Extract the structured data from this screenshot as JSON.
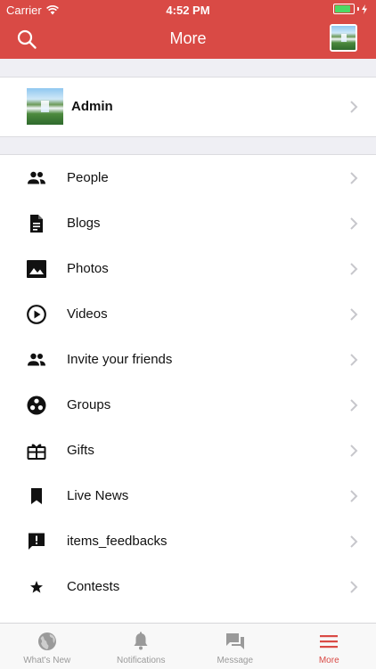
{
  "status_bar": {
    "carrier": "Carrier",
    "time": "4:52 PM",
    "battery_level": 0.95
  },
  "nav": {
    "title": "More",
    "search_icon": "search-icon",
    "avatar_icon": "user-avatar"
  },
  "admin": {
    "name": "Admin"
  },
  "menu": {
    "items": [
      {
        "label": "People",
        "icon": "people-icon"
      },
      {
        "label": "Blogs",
        "icon": "document-icon"
      },
      {
        "label": "Photos",
        "icon": "photo-icon"
      },
      {
        "label": "Videos",
        "icon": "play-circle-icon"
      },
      {
        "label": "Invite your friends",
        "icon": "people-icon"
      },
      {
        "label": "Groups",
        "icon": "groups-icon"
      },
      {
        "label": "Gifts",
        "icon": "gift-icon"
      },
      {
        "label": "Live News",
        "icon": "bookmark-icon"
      },
      {
        "label": "items_feedbacks",
        "icon": "feedback-icon"
      },
      {
        "label": "Contests",
        "icon": "star-icon"
      }
    ]
  },
  "tabbar": {
    "tabs": [
      {
        "label": "What's New",
        "icon": "globe-icon"
      },
      {
        "label": "Notifications",
        "icon": "bell-icon"
      },
      {
        "label": "Message",
        "icon": "chat-icon"
      },
      {
        "label": "More",
        "icon": "menu-icon",
        "active": true
      }
    ]
  },
  "colors": {
    "accent": "#d94a45",
    "inactive": "#9a9a9a"
  }
}
